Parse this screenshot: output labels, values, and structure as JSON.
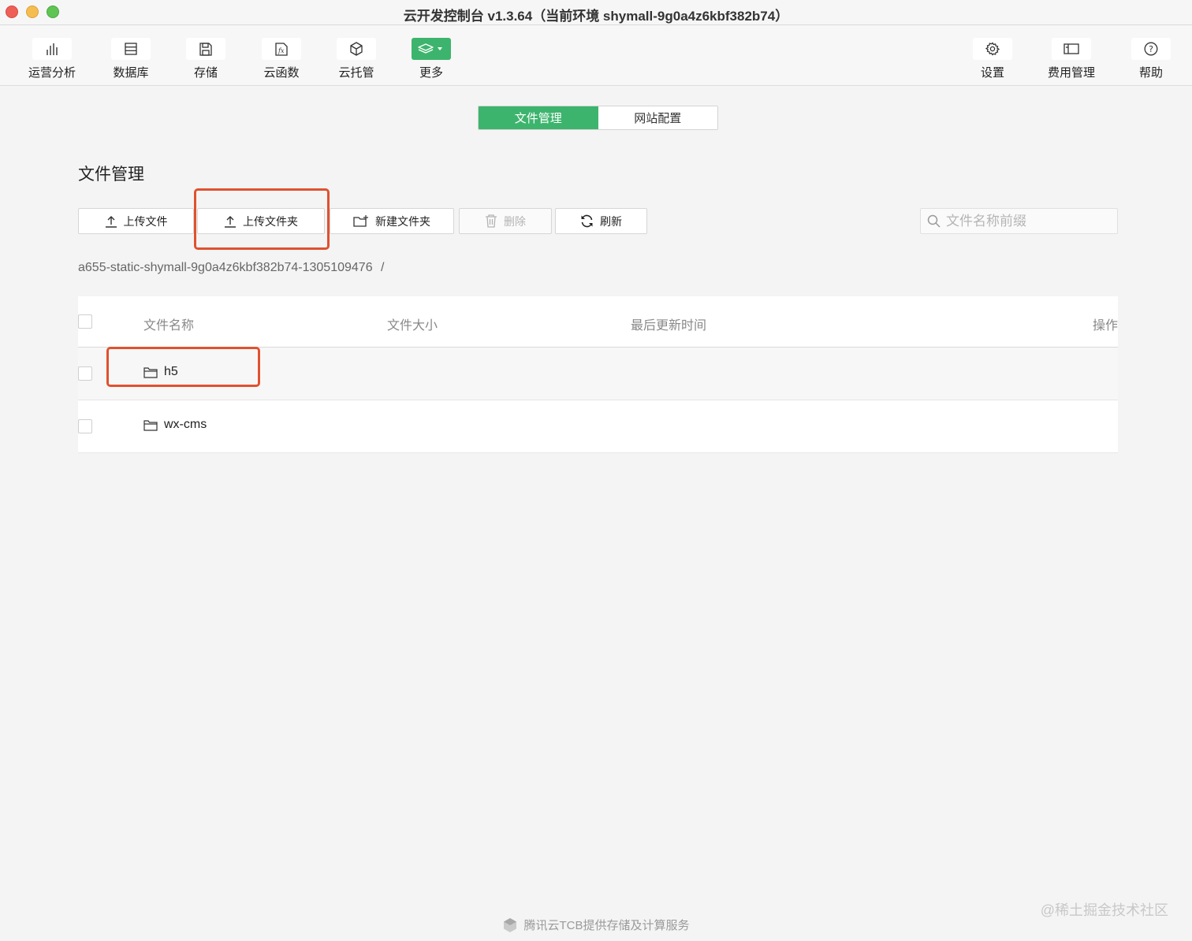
{
  "window": {
    "title": "云开发控制台 v1.3.64（当前环境 shymall-9g0a4z6kbf382b74）"
  },
  "toolbar": {
    "left": [
      {
        "label": "运营分析",
        "icon": "bar-chart-icon"
      },
      {
        "label": "数据库",
        "icon": "database-icon"
      },
      {
        "label": "存储",
        "icon": "storage-icon"
      },
      {
        "label": "云函数",
        "icon": "function-icon"
      },
      {
        "label": "云托管",
        "icon": "cube-icon"
      },
      {
        "label": "更多",
        "icon": "layers-icon"
      }
    ],
    "right": [
      {
        "label": "设置",
        "icon": "gear-icon"
      },
      {
        "label": "费用管理",
        "icon": "wallet-icon"
      },
      {
        "label": "帮助",
        "icon": "help-icon"
      }
    ],
    "accent_color": "#3db46d"
  },
  "tabs": [
    {
      "label": "文件管理",
      "active": true
    },
    {
      "label": "网站配置",
      "active": false
    }
  ],
  "page": {
    "title": "文件管理"
  },
  "actions": {
    "upload_file": "上传文件",
    "upload_folder": "上传文件夹",
    "new_folder": "新建文件夹",
    "delete": "删除",
    "refresh": "刷新"
  },
  "search": {
    "placeholder": "文件名称前缀",
    "value": ""
  },
  "breadcrumb": {
    "path": "a655-static-shymall-9g0a4z6kbf382b74-1305109476",
    "separator": "/"
  },
  "table": {
    "columns": [
      "文件名称",
      "文件大小",
      "最后更新时间",
      "操作"
    ],
    "rows": [
      {
        "name": "h5",
        "type": "folder",
        "size": "",
        "updated": ""
      },
      {
        "name": "wx-cms",
        "type": "folder",
        "size": "",
        "updated": ""
      }
    ]
  },
  "footer": {
    "text": "腾讯云TCB提供存储及计算服务"
  },
  "watermark": {
    "text": "@稀土掘金技术社区"
  },
  "highlight_color": "#e0512f"
}
